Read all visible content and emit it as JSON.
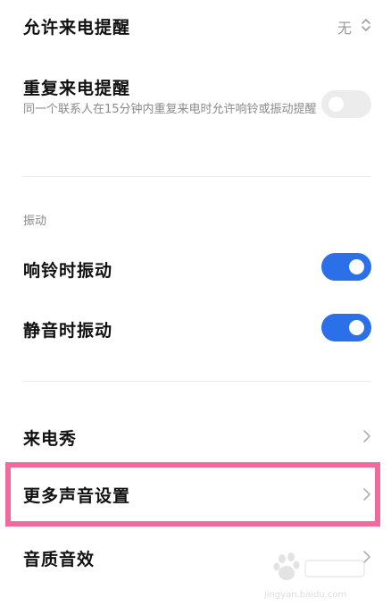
{
  "settings": {
    "allow_call_reminder": {
      "title": "允许来电提醒",
      "value": "无"
    },
    "repeat_call_reminder": {
      "title": "重复来电提醒",
      "description": "同一个联系人在15分钟内重复来电时允许响铃或振动提醒",
      "enabled": false
    },
    "vibration_section": {
      "label": "振动"
    },
    "vibrate_on_ring": {
      "title": "响铃时振动",
      "enabled": true
    },
    "vibrate_on_silent": {
      "title": "静音时振动",
      "enabled": true
    },
    "caller_show": {
      "title": "来电秀"
    },
    "more_sound_settings": {
      "title": "更多声音设置"
    },
    "sound_quality_effects": {
      "title": "音质音效"
    }
  },
  "colors": {
    "accent": "#2b6fe9",
    "highlight": "#f06b9b",
    "toggle_off": "#ececec",
    "secondary_text": "#8a8a8a"
  },
  "watermark": {
    "url": "jingyan.baidu.com"
  }
}
